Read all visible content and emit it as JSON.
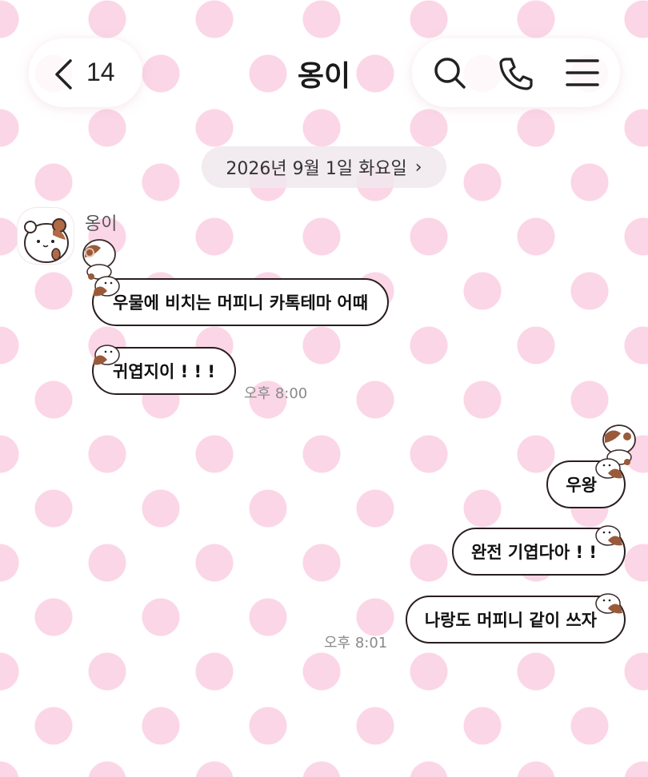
{
  "header": {
    "back_count": "14",
    "title": "옹이",
    "icons": [
      "back-chevron-icon",
      "search-icon",
      "phone-icon",
      "menu-icon"
    ]
  },
  "date_divider": {
    "label": "2026년 9월 1일 화요일",
    "chevron": "›"
  },
  "conversation": {
    "sender_name": "옹이",
    "incoming": [
      {
        "text": "우물에 비치는 머피니 카톡테마 어때"
      },
      {
        "text": "귀엽지이 ! ! !"
      }
    ],
    "incoming_time": "오후 8:00",
    "outgoing": [
      {
        "text": "우왕"
      },
      {
        "text": "완전 기엽다아 ! !"
      },
      {
        "text": "나랑도 머피니 같이 쓰자"
      }
    ],
    "outgoing_time": "오후 8:01"
  },
  "theme": {
    "background_dot": "#fbd6e6",
    "bubble_border": "#2a1d1f",
    "mascot_brown": "#9a5a3a"
  }
}
